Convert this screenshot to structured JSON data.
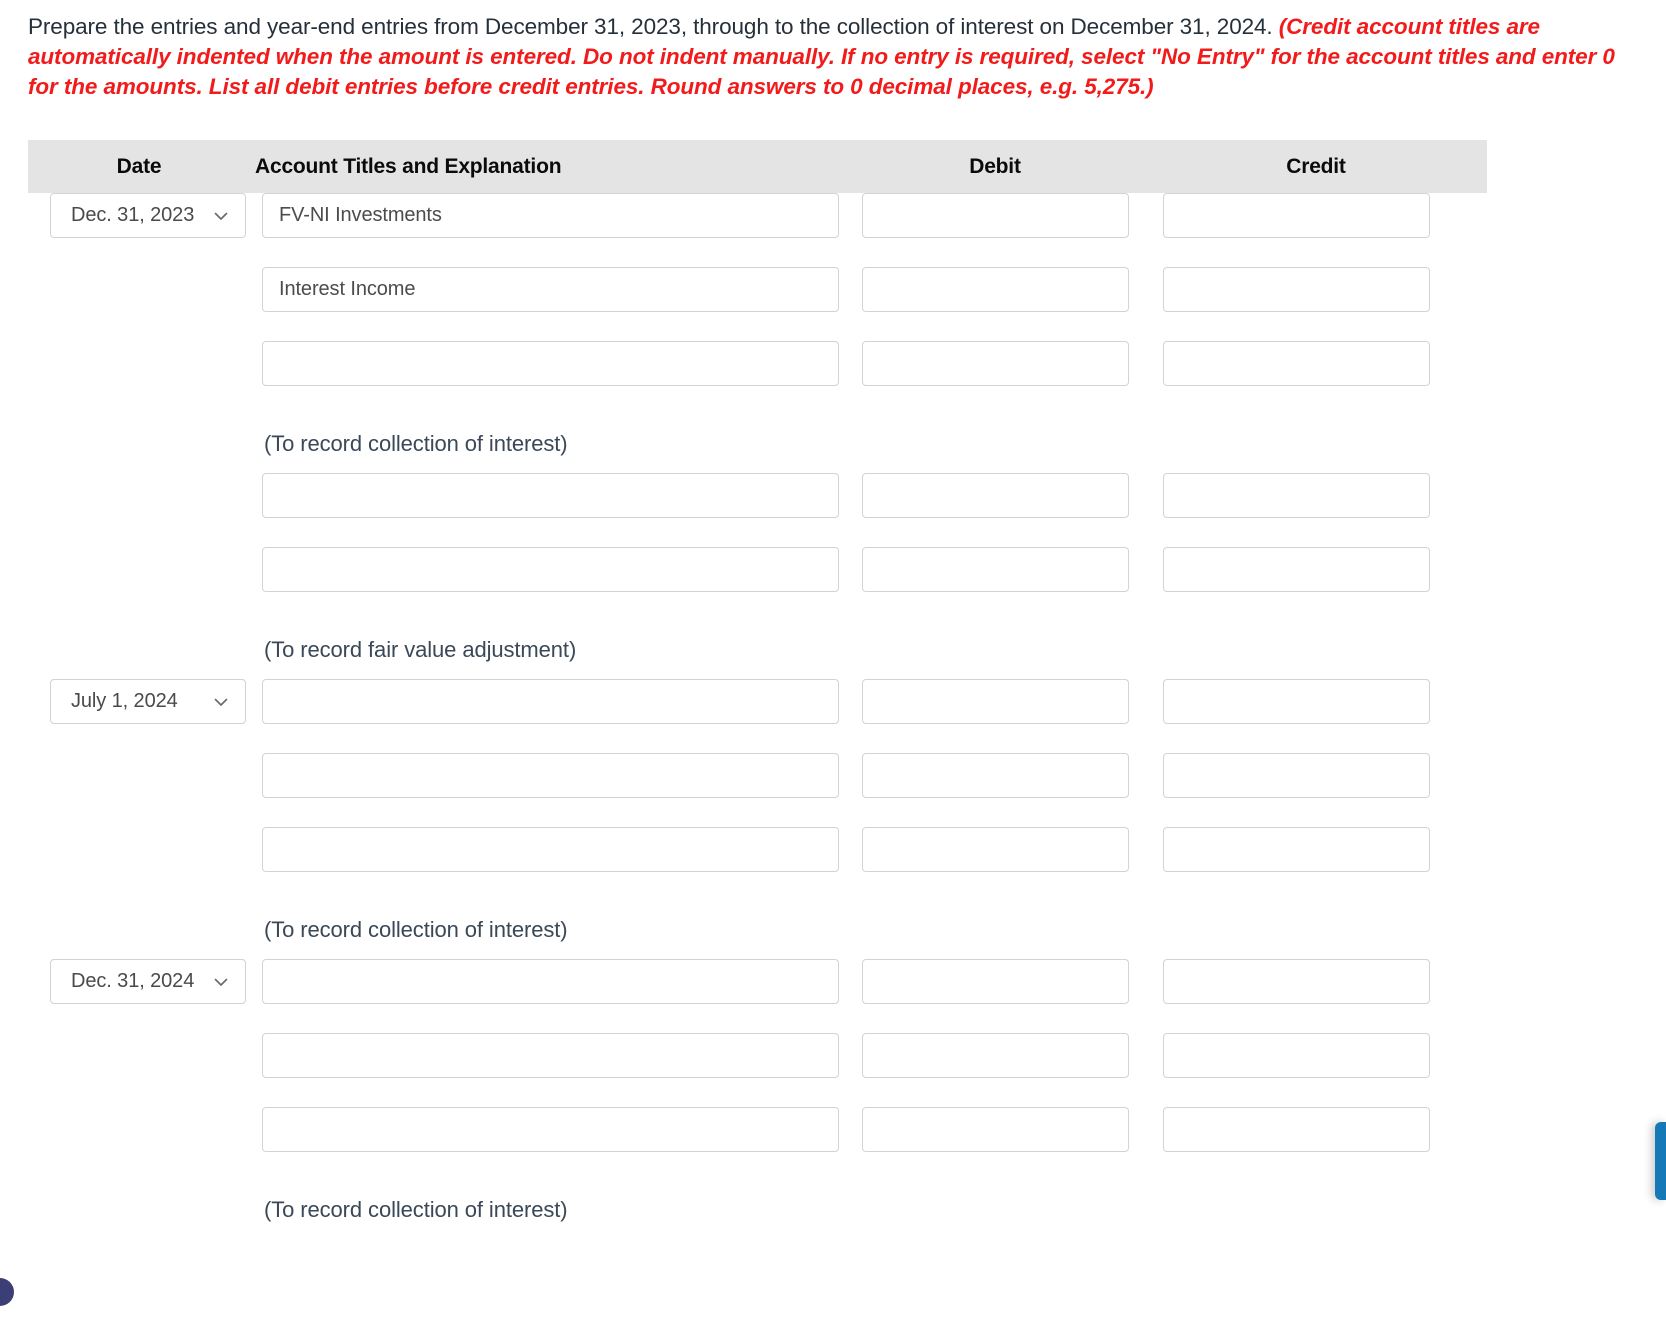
{
  "instructions": {
    "plain": "Prepare the entries and year-end entries from December 31, 2023, through to the collection of interest on December 31, 2024. ",
    "note": "(Credit account titles are automatically indented when the amount is entered. Do not indent manually. If no entry is required, select \"No Entry\" for the account titles and enter 0 for the amounts. List all debit entries before credit entries. Round answers to 0 decimal places, e.g. 5,275.)"
  },
  "table": {
    "headers": {
      "date": "Date",
      "account": "Account Titles and Explanation",
      "debit": "Debit",
      "credit": "Credit"
    },
    "rows": [
      {
        "kind": "entry",
        "date": "Dec. 31, 2023",
        "account": "FV-NI Investments",
        "debit": "",
        "credit": ""
      },
      {
        "kind": "entry",
        "date": "",
        "account": "Interest Income",
        "debit": "",
        "credit": ""
      },
      {
        "kind": "entry",
        "date": "",
        "account": "",
        "debit": "",
        "credit": ""
      },
      {
        "kind": "note",
        "text": "(To record collection of interest)"
      },
      {
        "kind": "entry",
        "date": "",
        "account": "",
        "debit": "",
        "credit": ""
      },
      {
        "kind": "entry",
        "date": "",
        "account": "",
        "debit": "",
        "credit": ""
      },
      {
        "kind": "note",
        "text": "(To record fair value adjustment)"
      },
      {
        "kind": "entry",
        "date": "July 1, 2024",
        "account": "",
        "debit": "",
        "credit": ""
      },
      {
        "kind": "entry",
        "date": "",
        "account": "",
        "debit": "",
        "credit": ""
      },
      {
        "kind": "entry",
        "date": "",
        "account": "",
        "debit": "",
        "credit": ""
      },
      {
        "kind": "note",
        "text": "(To record collection of interest)"
      },
      {
        "kind": "entry",
        "date": "Dec. 31, 2024",
        "account": "",
        "debit": "",
        "credit": ""
      },
      {
        "kind": "entry",
        "date": "",
        "account": "",
        "debit": "",
        "credit": ""
      },
      {
        "kind": "entry",
        "date": "",
        "account": "",
        "debit": "",
        "credit": ""
      },
      {
        "kind": "note",
        "text": "(To record collection of interest)"
      }
    ]
  },
  "decorations": {
    "right_tab_color": "#1579b8",
    "corner_dot_color": "#3c3e76",
    "header_bg": "#e4e4e4",
    "note_color": "#f21b1b"
  }
}
